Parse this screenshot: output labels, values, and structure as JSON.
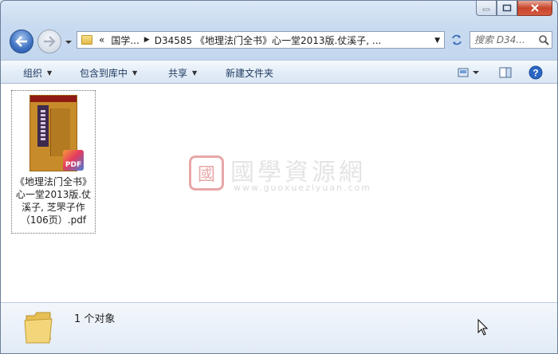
{
  "address": {
    "overflow": "«",
    "crumbs": [
      "国学...",
      "D34585 《地理法门全书》心一堂2013版.仗溪子, ..."
    ]
  },
  "search": {
    "placeholder": "搜索 D34..."
  },
  "toolbar": {
    "organize": "组织",
    "include_library": "包含到库中",
    "share": "共享",
    "new_folder": "新建文件夹"
  },
  "file": {
    "name": "《地理法门全书》心一堂2013版.仗溪子, 芝罘子作（106页）.pdf",
    "badge": "PDF"
  },
  "watermark": {
    "logo_char": "國",
    "title": "國學資源網",
    "url": "www.guoxueziyuan.com"
  },
  "status": {
    "count": "1 个对象"
  }
}
